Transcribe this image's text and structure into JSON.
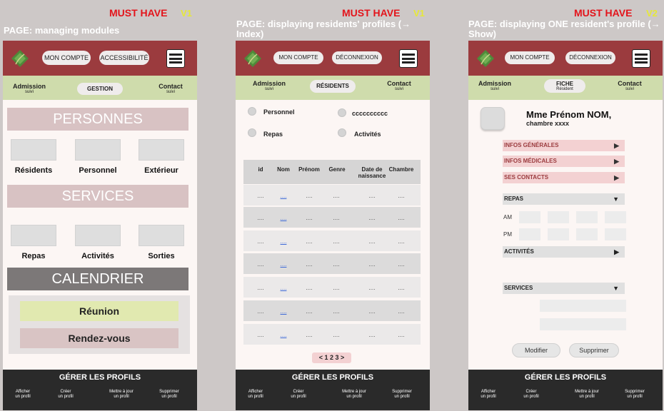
{
  "frames": [
    {
      "must_have": "MUST HAVE",
      "version": "V1",
      "page_title": "PAGE: managing modules",
      "header": {
        "btn1": "MON COMPTE",
        "btn2": "ACCESSIBILITÉ"
      },
      "nav": {
        "left": "Admission",
        "left_sub": "suivi",
        "center": "GESTION",
        "right": "Contact",
        "right_sub": "suivi"
      },
      "bars": {
        "personnes": "PERSONNES",
        "services": "SERVICES",
        "calendrier": "CALENDRIER"
      },
      "person_tiles": [
        "Résidents",
        "Personnel",
        "Extérieur"
      ],
      "service_tiles": [
        "Repas",
        "Activités",
        "Sorties"
      ],
      "calendar_items": [
        "Réunion",
        "Rendez-vous"
      ],
      "footer": {
        "title": "GÉRER LES PROFILS",
        "a1": "Afficher",
        "a1b": "un profil",
        "a2": "Créer",
        "a2b": "un profil",
        "a3": "Mettre à jour",
        "a3b": "un profil",
        "a4": "Supprimer",
        "a4b": "un profil"
      }
    },
    {
      "must_have": "MUST HAVE",
      "version": "V1",
      "page_title_1": "PAGE: displaying residents' profiles (→",
      "page_title_2": "Index)",
      "header": {
        "btn1": "MON COMPTE",
        "btn2": "DÉCONNEXION"
      },
      "nav": {
        "left": "Admission",
        "left_sub": "suivi",
        "center": "RÉSIDENTS",
        "right": "Contact",
        "right_sub": "suivi"
      },
      "filters": [
        "Personnel",
        "cccccccccc",
        "Repas",
        "Activités"
      ],
      "table_headers": [
        "id",
        "Nom",
        "Prénom",
        "Genre",
        "Date de naissance",
        "Chambre"
      ],
      "cell_placeholder": "....",
      "pagination": "< 1 2 3 >",
      "footer": {
        "title": "GÉRER LES PROFILS",
        "a1": "Afficher",
        "a1b": "un profil",
        "a2": "Créer",
        "a2b": "un profil",
        "a3": "Mettre à jour",
        "a3b": "un profil",
        "a4": "Supprimer",
        "a4b": "un profil"
      }
    },
    {
      "must_have": "MUST HAVE",
      "version": "V2",
      "page_title_1": "PAGE: displaying ONE resident's profile (→",
      "page_title_2": "Show)",
      "header": {
        "btn1": "MON COMPTE",
        "btn2": "DÉCONNEXION"
      },
      "nav": {
        "left": "Admission",
        "left_sub": "suivi",
        "center": "FICHE",
        "center_sub": "Résident",
        "right": "Contact",
        "right_sub": "suivi"
      },
      "resident_name": "Mme Prénom NOM,",
      "resident_room": "chambre xxxx",
      "sections": [
        "INFOS GÉNÉRALES",
        "INFOS MÉDICALES",
        "SES CONTACTS"
      ],
      "repas": "REPAS",
      "am": "AM",
      "pm": "PM",
      "activites": "ACTIVITÉS",
      "services": "SERVICES",
      "btn_modifier": "Modifier",
      "btn_supprimer": "Supprimer",
      "footer": {
        "title": "GÉRER LES PROFILS",
        "a1": "Afficher",
        "a1b": "un profil",
        "a2": "Créer",
        "a2b": "un profil",
        "a3": "Mettre à jour",
        "a3b": "un profil",
        "a4": "Supprimer",
        "a4b": "un profil"
      }
    }
  ],
  "colors": {
    "header": "#9b3b3e",
    "nav": "#cfdcac",
    "accent_pink": "#d9c4c4",
    "section_pink": "#f3d1d2",
    "footer": "#2a2a2a"
  },
  "icons": {
    "logo": "leaf-logo-icon",
    "menu": "hamburger-menu-icon",
    "arrow_right": "triangle-right-icon",
    "arrow_down": "triangle-down-icon"
  }
}
